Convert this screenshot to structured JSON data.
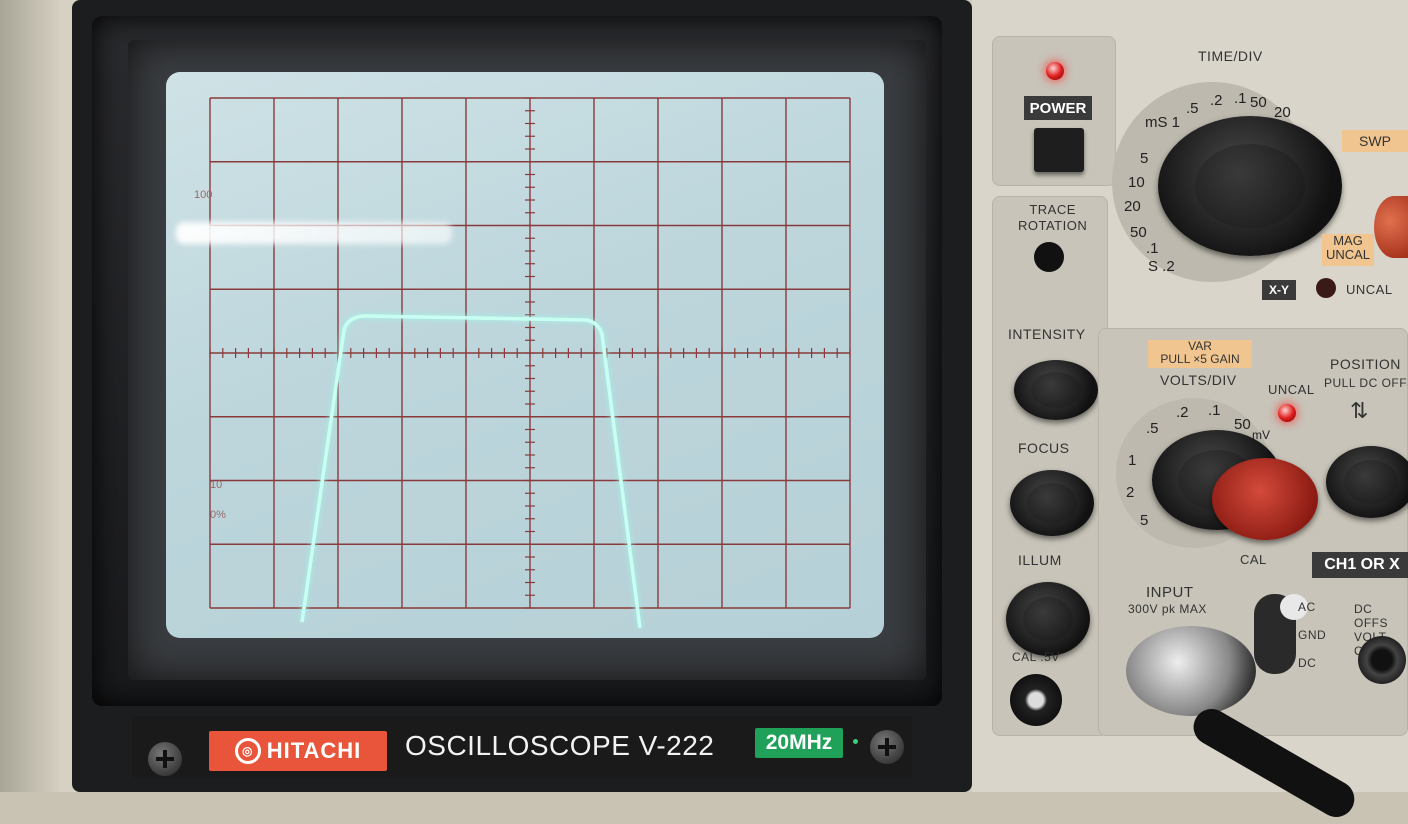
{
  "device": {
    "brand": "HITACHI",
    "model_text": "OSCILLOSCOPE V-222",
    "bandwidth_badge": "20MHz"
  },
  "screen": {
    "graticule_labels": {
      "top": "100",
      "mid": "10",
      "zero": "0%"
    },
    "trace_color": "#c8fff2",
    "grid_color": "#8a3a3a",
    "phosphor_color": "#bcd6dc"
  },
  "controls": {
    "power_label": "POWER",
    "trace_rotation_label": "TRACE\nROTATION",
    "intensity_label": "INTENSITY",
    "focus_label": "FOCUS",
    "illum_label": "ILLUM",
    "cal_label": "CAL .5V",
    "time_div_label": "TIME/DIV",
    "time_div_scale": [
      "mS 1",
      ".5",
      ".2",
      ".1",
      "50",
      "20",
      "5",
      "10",
      "20",
      "50",
      ".1",
      "S .2"
    ],
    "swp_label": "SWP",
    "mag_label": "MAG\nUNCAL",
    "xy_label": "X-Y",
    "uncal_label": "UNCAL",
    "var_label": "VAR\nPULL ×5 GAIN",
    "volts_div_label": "VOLTS/DIV",
    "volts_scale": [
      ".5",
      ".2",
      ".1",
      "50",
      "mV",
      "1",
      "2",
      "5"
    ],
    "uncal_led_label": "UNCAL",
    "position_label": "POSITION",
    "pull_dc_label": "PULL DC OFFS",
    "cal_knob_label": "CAL",
    "ch1_label": "CH1 OR X",
    "input_label": "INPUT",
    "input_max_label": "300V pk MAX",
    "coupling_options": [
      "AC",
      "GND",
      "DC"
    ],
    "dc_offset_label": "DC OFFS\nVOLT OU"
  }
}
